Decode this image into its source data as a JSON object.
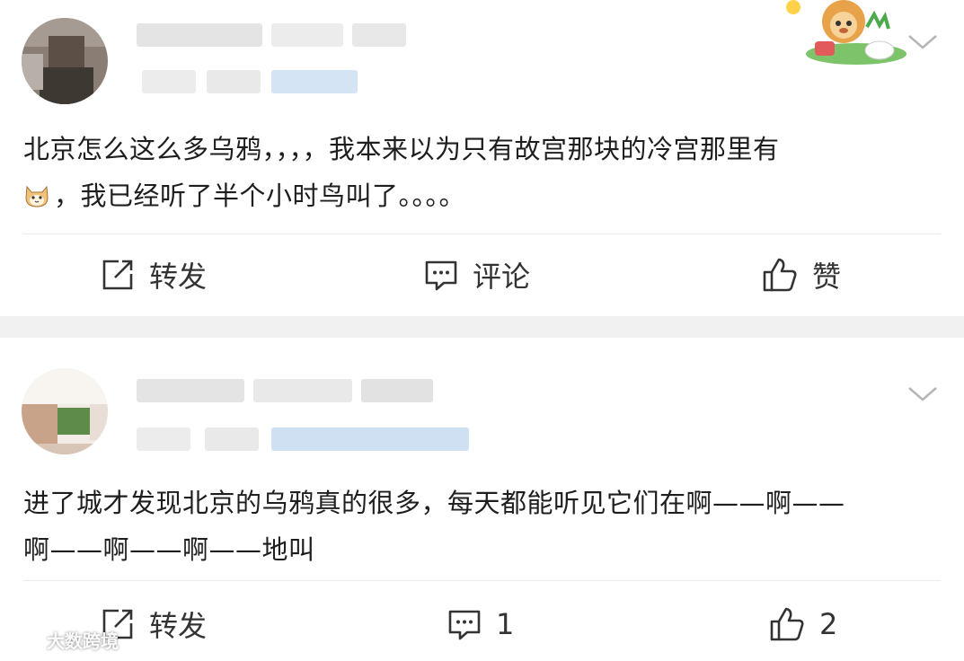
{
  "feed": {
    "posts": [
      {
        "text_line1": "北京怎么这么多乌鸦，，，，我本来以为只有故宫那块的冷宫那里有",
        "text_line2": "，我已经听了半个小时鸟叫了。。。。",
        "emoji": "cat-face-emoji",
        "actions": {
          "repost": "转发",
          "comment": "评论",
          "like": "赞"
        }
      },
      {
        "text_line1": "进了城才发现北京的乌鸦真的很多，每天都能听见它们在啊——啊——",
        "text_line2": "啊——啊——啊——地叫",
        "actions": {
          "repost": "转发",
          "comment": "1",
          "like": "2"
        }
      }
    ]
  },
  "watermark": {
    "text": "大数跨境"
  },
  "colors": {
    "separator": "#f1f1f1",
    "blur_link": "#b9d3ef",
    "text": "#1e1e1e"
  }
}
